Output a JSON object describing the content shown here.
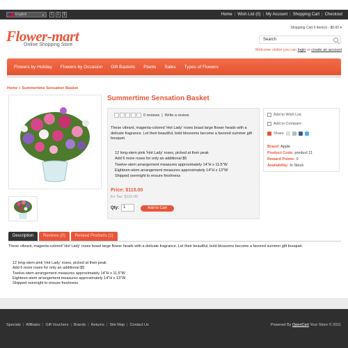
{
  "topbar": {
    "language": "English",
    "currencies": [
      "€",
      "£",
      "$"
    ],
    "links": [
      "Home",
      "Wish List (0)",
      "My Account",
      "Shopping Cart",
      "Checkout"
    ]
  },
  "header": {
    "logo": "Flower-mart",
    "tagline": "Online Shopping Store",
    "cart_info": "Shopping Cart 0 item(s) - $0.00",
    "search_placeholder": "Search",
    "welcome_prefix": "Welcome visitor you can",
    "login": "login",
    "welcome_or": "or",
    "create_account": "create an account"
  },
  "nav": [
    "Flowers by Holiday",
    "Flowers by Occasion",
    "Gift Baskets",
    "Plants",
    "Sales",
    "Types of Flowers"
  ],
  "breadcrumb": "Home » Summertime Sensation Basket",
  "product": {
    "title": "Summertime Sensation Basket",
    "reviews": "0 reviews",
    "write_review": "Write a review",
    "description": "These vibrant, magenta-colored 'Hot Lady' roses boast large flower heads with a delicate fragrance. Let their beautiful, bold blossoms become a favored summer gift bouquet.",
    "bullets": [
      "12 long-stem pink 'Hot Lady' roses, picked at their peak",
      "Add 6 more roses for only an additional $5",
      "Twelve-stem arrangement measures approximately 14\"H x 11.5\"W",
      "Eighteen-stem arrangement measures approximately 14\"H x 13\"W",
      "Shipped overnight to ensure freshness"
    ],
    "price": "Price: $115.00",
    "ex_tax": "Ex Tax: $115.00",
    "qty_label": "Qty:",
    "qty_value": "1",
    "add_to_cart": "Add to Cart"
  },
  "sidebox": {
    "wishlist": "Add to Wish List",
    "compare": "Add to Compare",
    "share": "Share",
    "brand_label": "Brand:",
    "brand_value": "Apple",
    "code_label": "Product Code:",
    "code_value": "product 11",
    "points_label": "Reward Points:",
    "points_value": "0",
    "avail_label": "Availability:",
    "avail_value": "In Stock"
  },
  "tabs": [
    "Description",
    "Reviews (0)",
    "Related Products (1)"
  ],
  "tab_content": {
    "description": "These vibrant, magenta-colored 'Hot Lady' roses boast large flower heads with a delicate fragrance. Let their beautiful, bold blossoms become a favored summer gift bouquet.",
    "bullets": [
      "12 long-stem pink 'Hot Lady' roses, picked at their peak",
      "Add 6 more roses for only an additional $5",
      "Twelve-stem arrangement measures approximately 14\"H x 11.5\"W",
      "Eighteen-stem arrangement measures approximately 14\"H x 13\"W",
      "Shipped overnight to ensure freshness"
    ]
  },
  "footer": {
    "links": [
      "Specials",
      "Affiliates",
      "Gift Vouchers",
      "Brands",
      "Returns",
      "Site Map",
      "Contact Us"
    ],
    "powered_prefix": "Powered By",
    "powered_link": "OpenCart",
    "powered_suffix": "Your Store © 2011"
  },
  "colors": {
    "accent": "#e8553a",
    "dark": "#2f2f2f"
  }
}
